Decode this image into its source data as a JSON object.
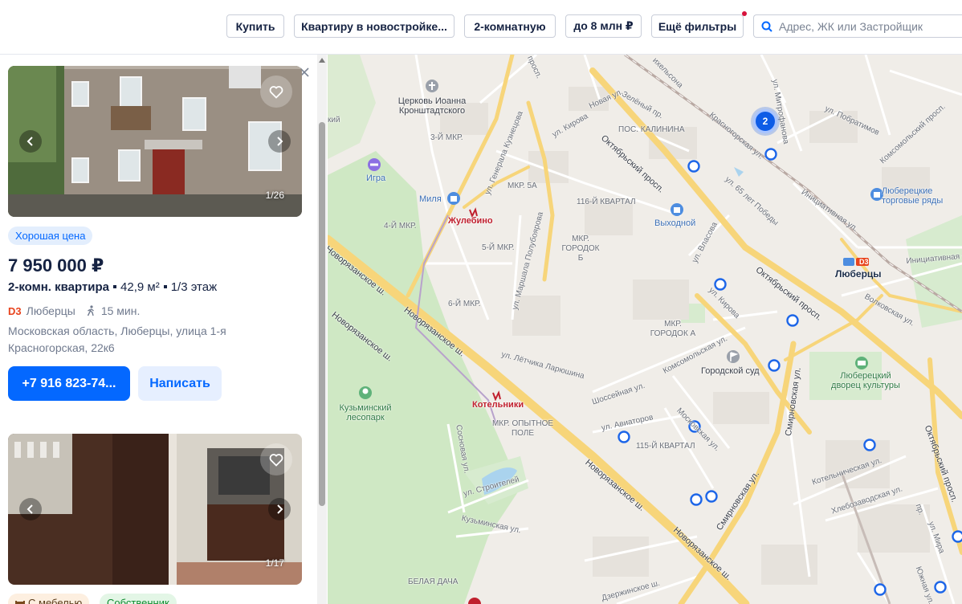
{
  "filters": {
    "deal": "Купить",
    "type": "Квартиру в новостройке...",
    "rooms": "2-комнатную",
    "price": "до 8 млн ₽",
    "more": "Ещё фильтры",
    "search_placeholder": "Адрес, ЖК или Застройщик"
  },
  "listing1": {
    "photo_counter": "1/26",
    "badge": "Хорошая цена",
    "price": "7 950 000 ₽",
    "rooms": "2-комн. квартира",
    "area": "42,9 м²",
    "floor": "1/3 этаж",
    "metro_line": "D3",
    "metro": "Люберцы",
    "walk": "15 мин.",
    "address": "Московская область, Люберцы, улица 1-я Красногорская, 22к6",
    "call": "+7 916 823-74...",
    "message": "Написать"
  },
  "listing2": {
    "photo_counter": "1/17",
    "badge1": "С мебелью",
    "badge2": "Собственник"
  },
  "map": {
    "cluster_count": "2",
    "labels": {
      "church": "Церковь Иоанна Кронштадтского",
      "igra": "Игра",
      "milya": "Миля",
      "zhulebino": "Жулебино",
      "vykhodnoy": "Выходной",
      "lyubertsy": "Люберцы",
      "rows": "Люберецкие торговые ряды",
      "court": "Городской суд",
      "palace": "Люберецкий дворец культуры",
      "kotelniki": "Котельники",
      "kuzminsky": "Кузьминский лесопарк",
      "belaya": "БЕЛАЯ ДАЧА",
      "opyt": "МКР. ОПЫТНОЕ ПОЛЕ",
      "kvartal115": "115-Й КВАРТАЛ",
      "kvartal116": "116-Й КВАРТАЛ",
      "gorodokA": "МКР. ГОРОДОК А",
      "gorodokB": "МКР. ГОРОДОК Б",
      "kalinina": "ПОС. КАЛИНИНА",
      "mkr3": "3-Й МКР.",
      "mkr4": "4-Й МКР.",
      "mkr5": "5-Й МКР.",
      "mkr5a": "МКР. 5А",
      "mkr6": "6-Й МКР.",
      "novoryaz1": "Новорязанское ш.",
      "novoryaz2": "Новорязанское ш.",
      "novoryaz3": "Новорязанское ш.",
      "novoryaz4": "Новорязанское ш.",
      "novoryaz5": "Новорязанское ш.",
      "oktyabr1": "Октябрьский просп.",
      "oktyabr2": "Октябрьский просп.",
      "oktyabr3": "Октябрьский просп.",
      "kirova1": "ул. Кирова",
      "kirova2": "ул. Кирова",
      "vlasova": "ул. Власова",
      "smirn1": "Смирновская ул.",
      "smirn2": "Смирновская ул.",
      "shosseinaya": "Шоссейная ул.",
      "komsom": "Комсомольская ул.",
      "moskovskaya": "Московская ул.",
      "aviatorov": "ул. Авиаторов",
      "stroiteley": "ул. Строителей",
      "kuzm": "Кузьминская ул.",
      "sosnovaya": "Сосновая ул.",
      "laryushina": "ул. Лётчика Ларюшина",
      "polubo": "ул. Маршала Полубоярова",
      "kuznetsova": "ул. Генерала Кузнецова",
      "dzerzh": "Дзержинское ш.",
      "kotelnich": "Котельническая ул.",
      "khlebo": "Хлебозаводская ул.",
      "mira": "ул. Мира",
      "yuzhnaya": "Южная ул.",
      "volkov": "Волковская ул.",
      "initsiat1": "Инициативная ул.",
      "initsiat2": "Инициативная ул.",
      "krasnogor": "Красногорская ул.",
      "mitrof": "ул. Митрофанова",
      "pobratimov": "ул. Побратимов",
      "komsom_pr": "Комсомольский просп.",
      "pobedy": "ул. 65 лет Победы",
      "zeleny": "Зелёный пр.",
      "novaya": "Новая ул.",
      "prosp": "просп.",
      "mikhelsona": "ихельсона",
      "kiy": "кий",
      "proezd": "пр.",
      "d3": "D3"
    }
  },
  "colors": {
    "accent": "#0468ff",
    "marker": "#1d66e8",
    "badge_dot": "#d6123c",
    "road_major": "#f7d57a",
    "park": "#cfe8c4"
  }
}
